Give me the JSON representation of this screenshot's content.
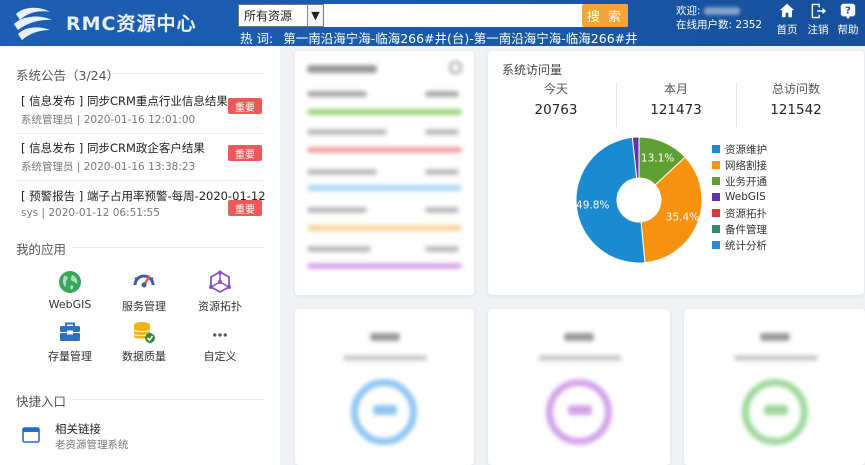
{
  "header": {
    "logo_text": "RMC资源中心",
    "search_scope": "所有资源",
    "search_button": "搜 索",
    "hot_label": "热 词:",
    "hot_words": "第一南沿海宁海-临海266#井(台)-第一南沿海宁海-临海266#井",
    "welcome_label": "欢迎:",
    "online_label": "在线用户数:",
    "online_count": "2352",
    "nav": [
      {
        "label": "首页",
        "icon": "home-icon"
      },
      {
        "label": "注销",
        "icon": "logout-icon"
      },
      {
        "label": "帮助",
        "icon": "help-icon"
      }
    ]
  },
  "notices": {
    "title": "系统公告（3/24）",
    "items": [
      {
        "title": "[ 信息发布 ] 同步CRM重点行业信息结果",
        "meta": "系统管理员 | 2020-01-16 12:01:00",
        "badge": "重要"
      },
      {
        "title": "[ 信息发布 ] 同步CRM政企客户结果",
        "meta": "系统管理员 | 2020-01-16 13:38:23",
        "badge": "重要"
      },
      {
        "title": "[ 预警报告 ] 端子占用率预警-每周-2020-01-12",
        "meta": "sys | 2020-01-12 06:51:55",
        "badge": "重要"
      }
    ]
  },
  "apps": {
    "title": "我的应用",
    "items": [
      {
        "label": "WebGIS",
        "icon": "globe-icon",
        "color": "#3aa55c"
      },
      {
        "label": "服务管理",
        "icon": "gauge-icon",
        "color": "#3a5ea8"
      },
      {
        "label": "资源拓扑",
        "icon": "topology-icon",
        "color": "#8a4fc7"
      },
      {
        "label": "存量管理",
        "icon": "toolbox-icon",
        "color": "#2f6fbf"
      },
      {
        "label": "数据质量",
        "icon": "database-check-icon",
        "color": "#f0b21b"
      },
      {
        "label": "自定义",
        "icon": "more-icon",
        "color": "#555555"
      }
    ]
  },
  "quick": {
    "title": "快捷入口",
    "link_title": "相关链接",
    "link_sub": "老资源管理系统"
  },
  "visits": {
    "title": "系统访问量",
    "stats": [
      {
        "label": "今天",
        "value": "20763"
      },
      {
        "label": "本月",
        "value": "121473"
      },
      {
        "label": "总访问数",
        "value": "121542"
      }
    ]
  },
  "chart_data": {
    "type": "pie",
    "donut": true,
    "legend_position": "right",
    "categories": [
      "资源维护",
      "网络割接",
      "业务开通",
      "WebGIS",
      "资源拓扑",
      "备件管理",
      "统计分析"
    ],
    "values": [
      49.8,
      35.4,
      13.1,
      1.7,
      0,
      0,
      0
    ],
    "value_labels": [
      "49.8%",
      "35.4%",
      "13.1%",
      "",
      "",
      "",
      ""
    ],
    "colors": [
      "#1b8ad1",
      "#f7920f",
      "#5fa033",
      "#6b2fa5",
      "#d33a3a",
      "#2d8a6e",
      "#2d8ad1"
    ]
  },
  "colors": {
    "header_bg": "#1a58a8",
    "search_button": "#f3a43b",
    "badge": "#e85b5b"
  }
}
